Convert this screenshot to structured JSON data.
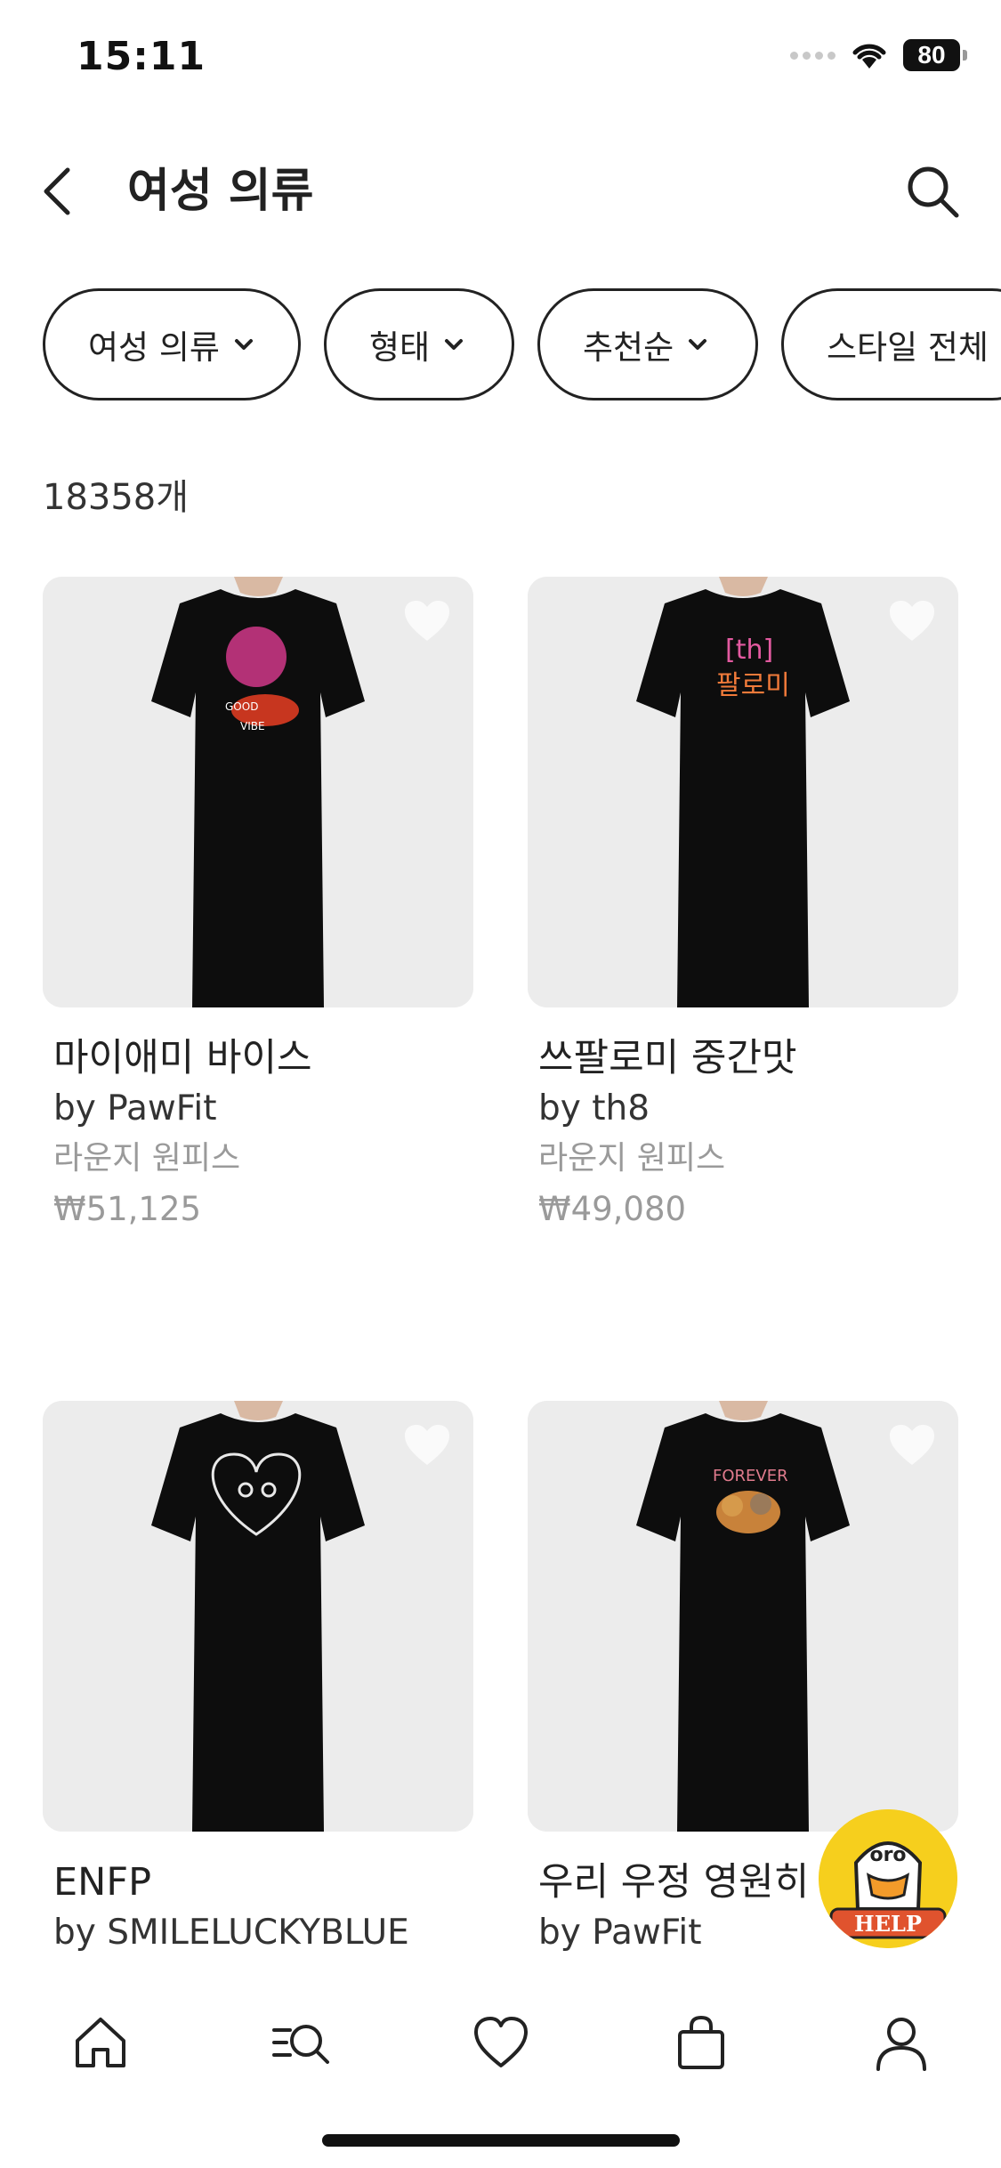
{
  "status_bar": {
    "time": "15:11",
    "battery": "80"
  },
  "header": {
    "title": "여성 의류"
  },
  "filters": [
    {
      "label": "여성 의류"
    },
    {
      "label": "형태"
    },
    {
      "label": "추천순"
    },
    {
      "label": "스타일 전체"
    }
  ],
  "result_count": "18358개",
  "products": [
    {
      "name": "마이애미 바이스",
      "brand": "by PawFit",
      "category": "라운지 원피스",
      "price": "₩51,125"
    },
    {
      "name": "쓰팔로미 중간맛",
      "brand": "by th8",
      "category": "라운지 원피스",
      "price": "₩49,080"
    },
    {
      "name": "ENFP",
      "brand": "by SMILELUCKYBLUE",
      "category": "",
      "price": ""
    },
    {
      "name": "우리 우정 영원히",
      "brand": "by PawFit",
      "category": "",
      "price": ""
    }
  ],
  "help_badge": {
    "label": "HELP",
    "mascot_text": "oro"
  },
  "bottom_nav": {
    "items": [
      {
        "icon": "home-icon"
      },
      {
        "icon": "category-search-icon"
      },
      {
        "icon": "heart-icon"
      },
      {
        "icon": "shopping-bag-icon"
      },
      {
        "icon": "user-icon"
      }
    ]
  },
  "colors": {
    "accent": "#222222",
    "help_yellow": "#f6cf1d",
    "muted_text": "#9a9a9a"
  }
}
